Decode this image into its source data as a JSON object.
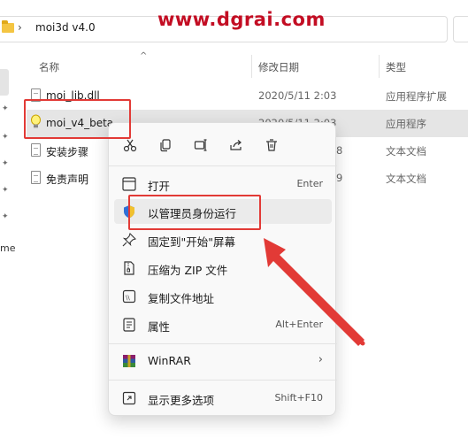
{
  "address": {
    "path": "moi3d v4.0"
  },
  "watermark": "www.dgrai.com",
  "columns": {
    "name": "名称",
    "date": "修改日期",
    "type": "类型"
  },
  "nav": {
    "partial_label": "me"
  },
  "files": [
    {
      "name": "moi_lib.dll",
      "date": "2020/5/11 2:03",
      "type": "应用程序扩展",
      "icon": "dll-file-icon",
      "selected": false
    },
    {
      "name": "moi_v4_beta",
      "date": "2020/5/11 2:03",
      "type": "应用程序",
      "icon": "lightbulb-app-icon",
      "selected": true
    },
    {
      "name": "安装步骤",
      "date": "8",
      "type": "文本文档",
      "icon": "text-file-icon",
      "selected": false
    },
    {
      "name": "免责声明",
      "date": "9",
      "type": "文本文档",
      "icon": "text-file-icon",
      "selected": false
    }
  ],
  "context_menu": {
    "quick_actions": [
      "cut-icon",
      "copy-icon",
      "rename-icon",
      "share-icon",
      "delete-icon"
    ],
    "items": [
      {
        "label": "打开",
        "shortcut": "Enter",
        "icon": "open-icon"
      },
      {
        "label": "以管理员身份运行",
        "shortcut": "",
        "icon": "shield-icon"
      },
      {
        "label": "固定到\"开始\"屏幕",
        "shortcut": "",
        "icon": "pin-icon"
      },
      {
        "label": "压缩为 ZIP 文件",
        "shortcut": "",
        "icon": "zip-icon"
      },
      {
        "label": "复制文件地址",
        "shortcut": "",
        "icon": "copy-path-icon"
      },
      {
        "label": "属性",
        "shortcut": "Alt+Enter",
        "icon": "properties-icon"
      },
      {
        "label": "WinRAR",
        "shortcut": "",
        "icon": "winrar-icon"
      },
      {
        "label": "显示更多选项",
        "shortcut": "Shift+F10",
        "icon": "more-options-icon"
      }
    ]
  },
  "colors": {
    "highlight": "#e23a36",
    "watermark": "#c30d23",
    "selection": "#e5e5e5",
    "shield_blue": "#2f6fd6"
  }
}
